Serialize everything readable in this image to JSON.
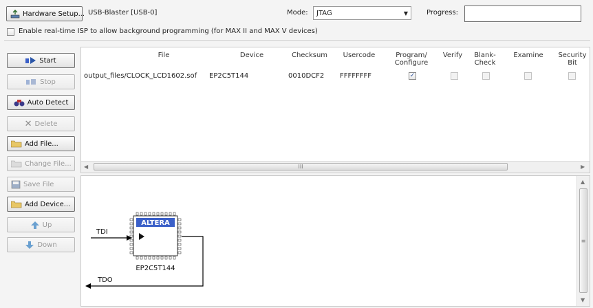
{
  "toolbar": {
    "hardware_setup_label": "Hardware Setup...",
    "hardware_value": "USB-Blaster [USB-0]",
    "mode_label": "Mode:",
    "mode_value": "JTAG",
    "progress_label": "Progress:",
    "isp_label": "Enable real-time ISP to allow background programming (for MAX II and MAX V devices)"
  },
  "side_buttons": [
    {
      "label": "Start",
      "icon": "start-icon",
      "enabled": true
    },
    {
      "label": "Stop",
      "icon": "stop-icon",
      "enabled": false
    },
    {
      "label": "Auto Detect",
      "icon": "auto-detect-icon",
      "enabled": true
    },
    {
      "label": "Delete",
      "icon": "delete-icon",
      "enabled": false
    },
    {
      "label": "Add File...",
      "icon": "folder-icon",
      "enabled": true
    },
    {
      "label": "Change File...",
      "icon": "folder-icon",
      "enabled": false
    },
    {
      "label": "Save File",
      "icon": "save-icon",
      "enabled": false
    },
    {
      "label": "Add Device...",
      "icon": "folder-icon",
      "enabled": true
    },
    {
      "label": "Up",
      "icon": "up-arrow-icon",
      "enabled": false
    },
    {
      "label": "Down",
      "icon": "down-arrow-icon",
      "enabled": false
    }
  ],
  "table": {
    "headers": {
      "file": "File",
      "device": "Device",
      "checksum": "Checksum",
      "usercode": "Usercode",
      "program_configure": "Program/ Configure",
      "verify": "Verify",
      "blank_check": "Blank- Check",
      "examine": "Examine",
      "security_bit": "Security Bit"
    },
    "rows": [
      {
        "file": "output_files/CLOCK_LCD1602.sof",
        "device": "EP2C5T144",
        "checksum": "0010DCF2",
        "usercode": "FFFFFFFF",
        "program_configure": true,
        "verify": false,
        "blank_check": false,
        "examine": false,
        "security_bit": false
      }
    ],
    "scrollbar_grip": "III"
  },
  "diagram": {
    "tdi_label": "TDI",
    "tdo_label": "TDO",
    "chip_logo": "ALTERA",
    "device_label": "EP2C5T144"
  },
  "colors": {
    "altera_blue": "#3a5fc8",
    "arrow": "#000000"
  }
}
